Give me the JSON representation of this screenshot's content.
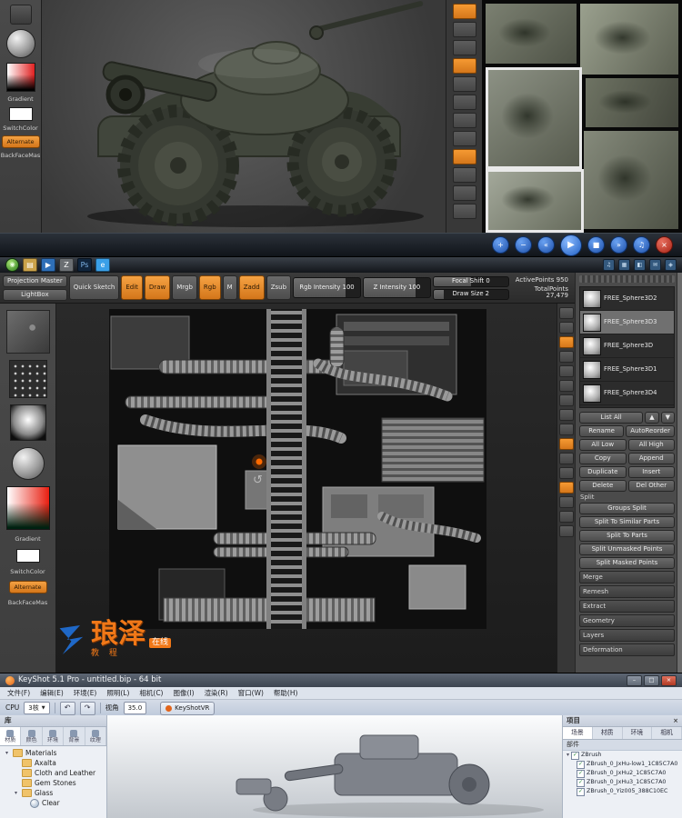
{
  "colors": {
    "zbrush_orange": "#e08214",
    "player_blue": "#2b6cd4",
    "player_red": "#b03024",
    "keyshot_orange": "#e2641b",
    "watermark_blue": "#1f6fd6",
    "watermark_orange": "#f07818"
  },
  "top": {
    "shelf": {
      "gradient": "Gradient",
      "switch": "SwitchColor",
      "alternate": "Alternate",
      "backface": "BackFaceMas"
    },
    "player": [
      {
        "name": "zoom-in",
        "glyph": "+"
      },
      {
        "name": "zoom-out",
        "glyph": "−"
      },
      {
        "name": "skip-start",
        "glyph": "«"
      },
      {
        "name": "play",
        "glyph": "▶"
      },
      {
        "name": "stop",
        "glyph": "■"
      },
      {
        "name": "skip-end",
        "glyph": "»"
      },
      {
        "name": "volume",
        "glyph": "♫"
      },
      {
        "name": "close",
        "glyph": "×"
      }
    ]
  },
  "taskbar": {
    "start_glyph": "◉",
    "icons": [
      {
        "glyph": "▤"
      },
      {
        "glyph": "▶"
      },
      {
        "glyph": "Z"
      },
      {
        "glyph": "Ps"
      },
      {
        "glyph": "e"
      }
    ],
    "tray": [
      {
        "glyph": "♫"
      },
      {
        "glyph": "▦"
      },
      {
        "glyph": "◧"
      },
      {
        "glyph": "✉"
      },
      {
        "glyph": "◈"
      }
    ]
  },
  "zb": {
    "toolbar": {
      "projection_master": "Projection Master",
      "lightbox": "LightBox",
      "quick_sketch": "Quick Sketch",
      "edit": "Edit",
      "draw": "Draw",
      "mrgb": "Mrgb",
      "rgb": "Rgb",
      "m": "M",
      "zadd": "Zadd",
      "zsub": "Zsub",
      "rgb_intensity": "Rgb Intensity 100",
      "z_intensity": "Z Intensity 100",
      "focal_shift": "Focal Shift 0",
      "draw_size": "Draw Size 2",
      "active_points": "ActivePoints 950",
      "total_points": "TotalPoints 27,479"
    },
    "shelf": {
      "gradient": "Gradient",
      "switch": "SwitchColor",
      "alternate": "Alternate",
      "backface": "BackFaceMas"
    },
    "watermark": {
      "brand": "琅泽",
      "sub": "在线",
      "tagline": "教 程"
    },
    "subtool": {
      "items": [
        {
          "label": "FREE_Sphere3D2"
        },
        {
          "label": "FREE_Sphere3D3"
        },
        {
          "label": "FREE_Sphere3D"
        },
        {
          "label": "FREE_Sphere3D1"
        },
        {
          "label": "FREE_Sphere3D4"
        }
      ],
      "list_all": "List All",
      "up": "▲",
      "down": "▼",
      "rows": [
        [
          "Rename",
          "AutoReorder"
        ],
        [
          "All Low",
          "All High"
        ],
        [
          "Copy",
          "Append"
        ],
        [
          "Duplicate",
          "Insert"
        ],
        [
          "Delete",
          "Del Other"
        ]
      ],
      "split_label": "Split",
      "split_buttons": [
        "Groups Split",
        "Split To Similar Parts",
        "Split To Parts",
        "Split Unmasked Points",
        "Split Masked Points"
      ],
      "sections": [
        "Merge",
        "Remesh",
        "Extract",
        "Geometry",
        "Layers",
        "Deformation"
      ]
    }
  },
  "ks": {
    "title": "KeyShot 5.1 Pro - untitled.bip - 64 bit",
    "caps": [
      "–",
      "□",
      "×"
    ],
    "menus": [
      "文件(F)",
      "编辑(E)",
      "环境(E)",
      "照明(L)",
      "相机(C)",
      "图像(I)",
      "渲染(R)",
      "窗口(W)",
      "帮助(H)"
    ],
    "toolbar": {
      "cpu": "CPU",
      "cores": "3核",
      "undo": "↶",
      "redo": "↷",
      "fov_label": "视角",
      "fov": "35.0",
      "vr": "KeyShotVR"
    },
    "library": {
      "title": "库",
      "tabs": [
        "材质",
        "颜色",
        "环境",
        "背景",
        "纹理"
      ],
      "tree": [
        {
          "arrow": "▾",
          "label": "Materials"
        },
        {
          "arrow": "",
          "label": "Axalta"
        },
        {
          "arrow": "",
          "label": "Cloth and Leather"
        },
        {
          "arrow": "",
          "label": "Gem Stones"
        },
        {
          "arrow": "▾",
          "label": "Glass"
        },
        {
          "arrow": "",
          "label": "Clear"
        }
      ]
    },
    "project": {
      "title": "项目",
      "close": "×",
      "tabs": [
        "场景",
        "材质",
        "环境",
        "相机"
      ],
      "parts_label": "部件",
      "root": "ZBrush",
      "root_arrow": "▾",
      "check": "✓",
      "parts": [
        "ZBrush_0_JxHu-low1_1C85C7A0",
        "ZBrush_0_JxHu2_1C85C7A0",
        "ZBrush_0_JxHu3_1C85C7A0",
        "ZBrush_0_Yiz005_388C10EC"
      ]
    }
  }
}
